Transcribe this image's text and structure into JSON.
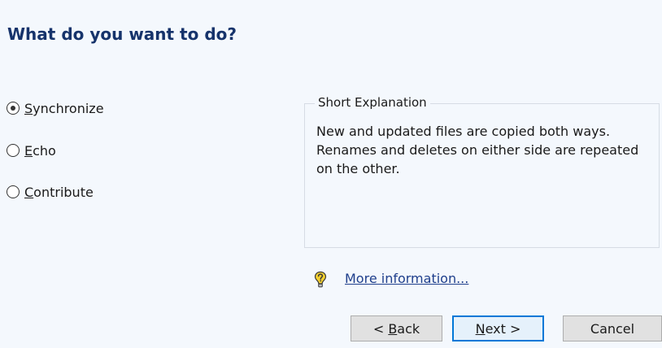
{
  "heading": "What do you want to do?",
  "options": [
    {
      "mnemonic": "S",
      "rest": "ynchronize",
      "selected": true
    },
    {
      "mnemonic": "E",
      "rest": "cho",
      "selected": false
    },
    {
      "mnemonic": "C",
      "rest": "ontribute",
      "selected": false
    }
  ],
  "explanation": {
    "title": "Short Explanation",
    "text": "New and updated files are copied both ways. Renames and deletes on either side are repeated on the other."
  },
  "more_info": {
    "icon": "question-bulb-icon",
    "label": "More information..."
  },
  "buttons": {
    "back": {
      "prefix": "< ",
      "mnemonic": "B",
      "rest": "ack"
    },
    "next": {
      "prefix": "",
      "mnemonic": "N",
      "rest": "ext >"
    },
    "cancel": {
      "label": "Cancel"
    }
  },
  "colors": {
    "panel_bg": "#f4f8fd",
    "heading": "#16336b",
    "link": "#1f3f8c",
    "default_button_border": "#0078d7"
  }
}
